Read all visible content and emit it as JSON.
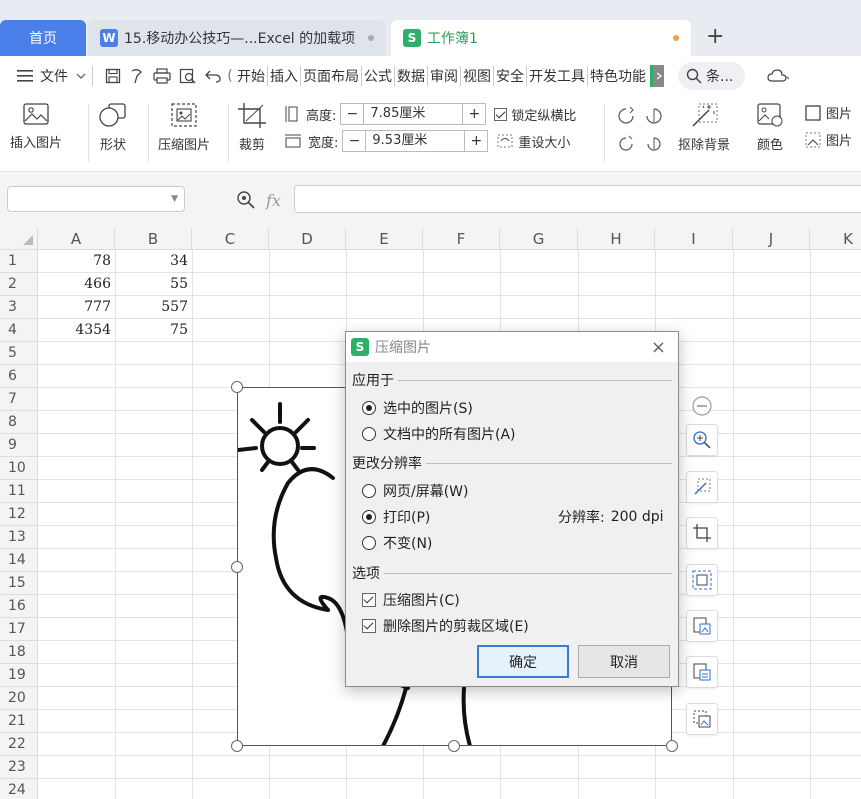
{
  "tabs": {
    "home": "首页",
    "doc": "15.移动办公技巧—...Excel 的加载项",
    "doc_badge": "W",
    "book": "工作簿1",
    "book_badge": "S",
    "plus": "+"
  },
  "menu": {
    "file": "文件",
    "items": [
      "开始",
      "插入",
      "页面布局",
      "公式",
      "数据",
      "审阅",
      "视图",
      "安全",
      "开发工具",
      "特色功能"
    ],
    "search": "条..."
  },
  "ribbon": {
    "insert_picture": "插入图片",
    "shape": "形状",
    "compress_picture": "压缩图片",
    "crop": "裁剪",
    "height_label": "高度:",
    "height_value": "7.85厘米",
    "width_label": "宽度:",
    "width_value": "9.53厘米",
    "lock_ratio": "锁定纵横比",
    "reset_size": "重设大小",
    "remove_background": "抠除背景",
    "color": "颜色",
    "picture_a": "图片",
    "picture_b": "图片"
  },
  "formula_bar": {
    "fx": "fx",
    "value": ""
  },
  "columns": [
    "A",
    "B",
    "C",
    "D",
    "E",
    "F",
    "G",
    "H",
    "I",
    "J",
    "K"
  ],
  "rows": [
    "1",
    "2",
    "3",
    "4",
    "5",
    "6",
    "7",
    "8",
    "9",
    "10",
    "11",
    "12",
    "13",
    "14",
    "15",
    "16",
    "17",
    "18",
    "19",
    "20",
    "21",
    "22",
    "23",
    "24"
  ],
  "cells": {
    "A1": "78",
    "B1": "34",
    "A2": "466",
    "B2": "55",
    "A3": "777",
    "B3": "557",
    "A4": "4354",
    "B4": "75"
  },
  "dialog": {
    "title": "压缩图片",
    "badge": "S",
    "close": "×",
    "apply_to": "应用于",
    "opt_selected": "选中的图片(S)",
    "opt_all": "文档中的所有图片(A)",
    "change_resolution": "更改分辨率",
    "opt_web": "网页/屏幕(W)",
    "opt_print": "打印(P)",
    "resolution_label": "分辨率:",
    "resolution_value": "200 dpi",
    "opt_nochange": "不变(N)",
    "options": "选项",
    "chk_compress": "压缩图片(C)",
    "chk_delete_crop": "删除图片的剪裁区域(E)",
    "ok": "确定",
    "cancel": "取消"
  },
  "colors": {
    "accent": "#4a7ee8",
    "wps_green": "#2db069",
    "primary_border": "#3b7bd4"
  }
}
